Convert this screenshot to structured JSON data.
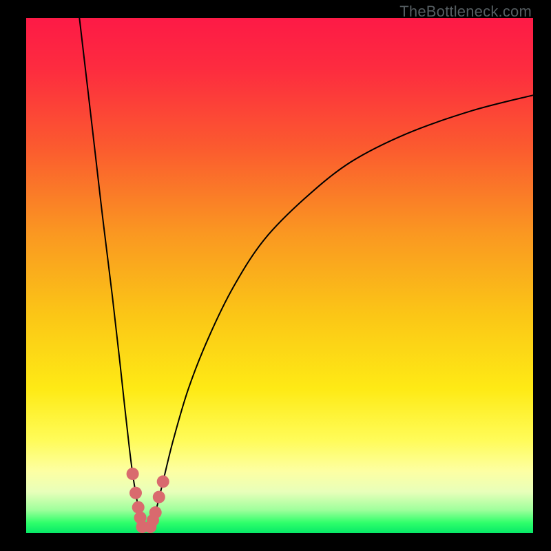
{
  "watermark": {
    "text": "TheBottleneck.com"
  },
  "colors": {
    "frame": "#000000",
    "curve": "#000000",
    "dot": "#d96a6e",
    "grad_stops": [
      {
        "offset": 0.0,
        "color": "#fd1a46"
      },
      {
        "offset": 0.1,
        "color": "#fd2c3f"
      },
      {
        "offset": 0.25,
        "color": "#fb5a2f"
      },
      {
        "offset": 0.42,
        "color": "#fa9821"
      },
      {
        "offset": 0.58,
        "color": "#fbc716"
      },
      {
        "offset": 0.72,
        "color": "#feea15"
      },
      {
        "offset": 0.82,
        "color": "#fffc59"
      },
      {
        "offset": 0.88,
        "color": "#fdffa3"
      },
      {
        "offset": 0.92,
        "color": "#e8ffba"
      },
      {
        "offset": 0.955,
        "color": "#9fff9c"
      },
      {
        "offset": 0.98,
        "color": "#2fff6a"
      },
      {
        "offset": 1.0,
        "color": "#06e968"
      }
    ]
  },
  "chart_data": {
    "type": "line",
    "title": "",
    "xlabel": "",
    "ylabel": "",
    "xlim": [
      0,
      100
    ],
    "ylim": [
      0,
      100
    ],
    "series": [
      {
        "name": "left-branch",
        "x": [
          10.5,
          13.0,
          15.0,
          17.0,
          18.5,
          19.5,
          20.3,
          21.0,
          21.6,
          22.1,
          22.5,
          22.9
        ],
        "y": [
          100.0,
          79.0,
          62.0,
          46.0,
          33.0,
          24.0,
          17.0,
          11.5,
          7.8,
          5.0,
          3.0,
          1.2
        ]
      },
      {
        "name": "right-branch",
        "x": [
          24.5,
          25.5,
          27.0,
          29.0,
          32.0,
          36.0,
          41.0,
          47.0,
          55.0,
          64.0,
          75.0,
          88.0,
          100.0
        ],
        "y": [
          1.2,
          4.0,
          10.0,
          18.0,
          28.0,
          38.0,
          48.0,
          57.0,
          65.0,
          72.0,
          77.5,
          82.0,
          85.0
        ]
      }
    ],
    "floor": {
      "name": "valley-floor",
      "x": [
        22.9,
        24.5
      ],
      "y": [
        1.2,
        1.2
      ]
    },
    "dots": {
      "name": "valley-dots",
      "points": [
        {
          "x": 21.0,
          "y": 11.5
        },
        {
          "x": 21.6,
          "y": 7.8
        },
        {
          "x": 22.1,
          "y": 5.0
        },
        {
          "x": 22.5,
          "y": 3.0
        },
        {
          "x": 22.9,
          "y": 1.2
        },
        {
          "x": 24.5,
          "y": 1.2
        },
        {
          "x": 25.0,
          "y": 2.5
        },
        {
          "x": 25.5,
          "y": 4.0
        },
        {
          "x": 26.2,
          "y": 7.0
        },
        {
          "x": 27.0,
          "y": 10.0
        }
      ]
    }
  }
}
